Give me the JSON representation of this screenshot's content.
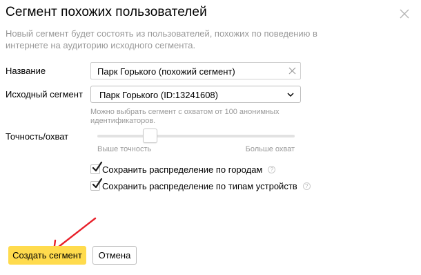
{
  "dialog": {
    "title": "Сегмент похожих пользователей",
    "description": "Новый сегмент будет состоять из пользователей, похожих по поведению в интернете на аудиторию исходного сегмента.",
    "close_icon": "close-icon"
  },
  "form": {
    "name_label": "Название",
    "name_value": "Парк Горького (похожий сегмент)",
    "source_label": "Исходный сегмент",
    "source_value": "Парк Горького (ID:13241608)",
    "source_hint": "Можно выбрать сегмент с охватом от 100 анонимных идентификаторов.",
    "accuracy_label": "Точность/охват",
    "slider_min_label": "Выше точность",
    "slider_max_label": "Больше охват",
    "slider_value": 0.25,
    "checkbox_cities_label": "Сохранить распределение по городам",
    "checkbox_cities_checked": true,
    "checkbox_devices_label": "Сохранить распределение по типам устройств",
    "checkbox_devices_checked": true,
    "help_glyph": "?"
  },
  "buttons": {
    "create_label": "Создать сегмент",
    "cancel_label": "Отмена"
  },
  "colors": {
    "primary_button": "#ffdb4d",
    "checkmark": "#1a1a1a",
    "annotation_arrow": "#e8202a"
  }
}
